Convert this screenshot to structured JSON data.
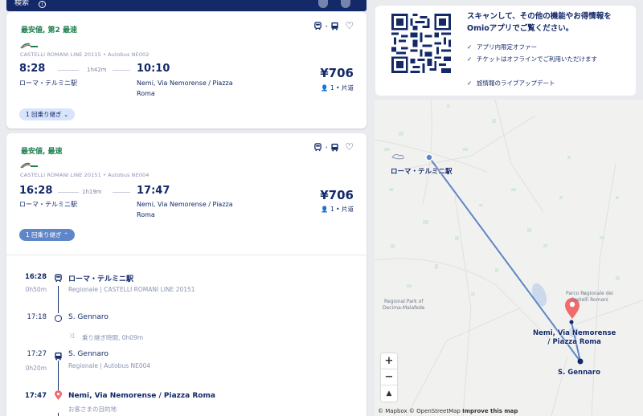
{
  "header": {
    "title": "検索"
  },
  "results": [
    {
      "badge": "最安値, 第2 最速",
      "operator": "CASTELLI ROMANI LINE 20115 • Autobus NE002",
      "dep_time": "8:28",
      "duration": "1h42m",
      "arr_time": "10:10",
      "dep_station": "ローマ・テルミニ駅",
      "arr_station_line1": "Nemi, Via Nemorense / Piazza",
      "arr_station_line2": "Roma",
      "price": "¥706",
      "passengers": "1 • 片道",
      "transfers": "1 回乗り継ぎ"
    },
    {
      "badge": "最安値, 最速",
      "operator": "CASTELLI ROMANI LINE 20151 • Autobus NE004",
      "dep_time": "16:28",
      "duration": "1h19m",
      "arr_time": "17:47",
      "dep_station": "ローマ・テルミニ駅",
      "arr_station_line1": "Nemi, Via Nemorense / Piazza",
      "arr_station_line2": "Roma",
      "price": "¥706",
      "passengers": "1 • 片道",
      "transfers": "1 回乗り継ぎ"
    }
  ],
  "itinerary": {
    "stop1": {
      "time": "16:28",
      "name": "ローマ・テルミニ駅",
      "sub": "Regionale | CASTELLI ROMANI LINE 20151",
      "dur": "0h50m"
    },
    "stop2": {
      "time": "17:18",
      "name": "S. Gennaro"
    },
    "transfer": "乗り継ぎ時間, 0h09m",
    "stop3": {
      "time": "17:27",
      "name": "S. Gennaro",
      "sub": "Regionale | Autobus NE004",
      "dur": "0h20m"
    },
    "stop4": {
      "time": "17:47",
      "name": "Nemi, Via Nemorense / Piazza Roma",
      "sub": "お客さまの目的地"
    }
  },
  "promo": {
    "title": "スキャンして、その他の機能やお得情報をOmioアプリでご覧ください。",
    "features": [
      "アプリ内限定オファー",
      "チケットはオフラインでご利用いただけます",
      "旅情報のライブアップデート"
    ]
  },
  "map": {
    "origin": "ローマ・テルミニ駅",
    "dest_line1": "Nemi, Via Nemorense",
    "dest_line2": "/ Piazza Roma",
    "transfer_stop": "S. Gennaro",
    "park1_line1": "Regional Park of",
    "park1_line2": "Decima-Malafede",
    "park2_line1": "Parco Regionale dei",
    "park2_line2": "Castelli Romani",
    "zoom_in": "+",
    "zoom_out": "−",
    "compass": "▲",
    "attribution_mapbox": "© Mapbox",
    "attribution_osm": "© OpenStreetMap",
    "attribution_improve": "Improve this map"
  },
  "colors": {
    "navy": "#132968",
    "green": "#1f7f4f",
    "pin": "#f26b6b",
    "route": "#5f86c8"
  }
}
